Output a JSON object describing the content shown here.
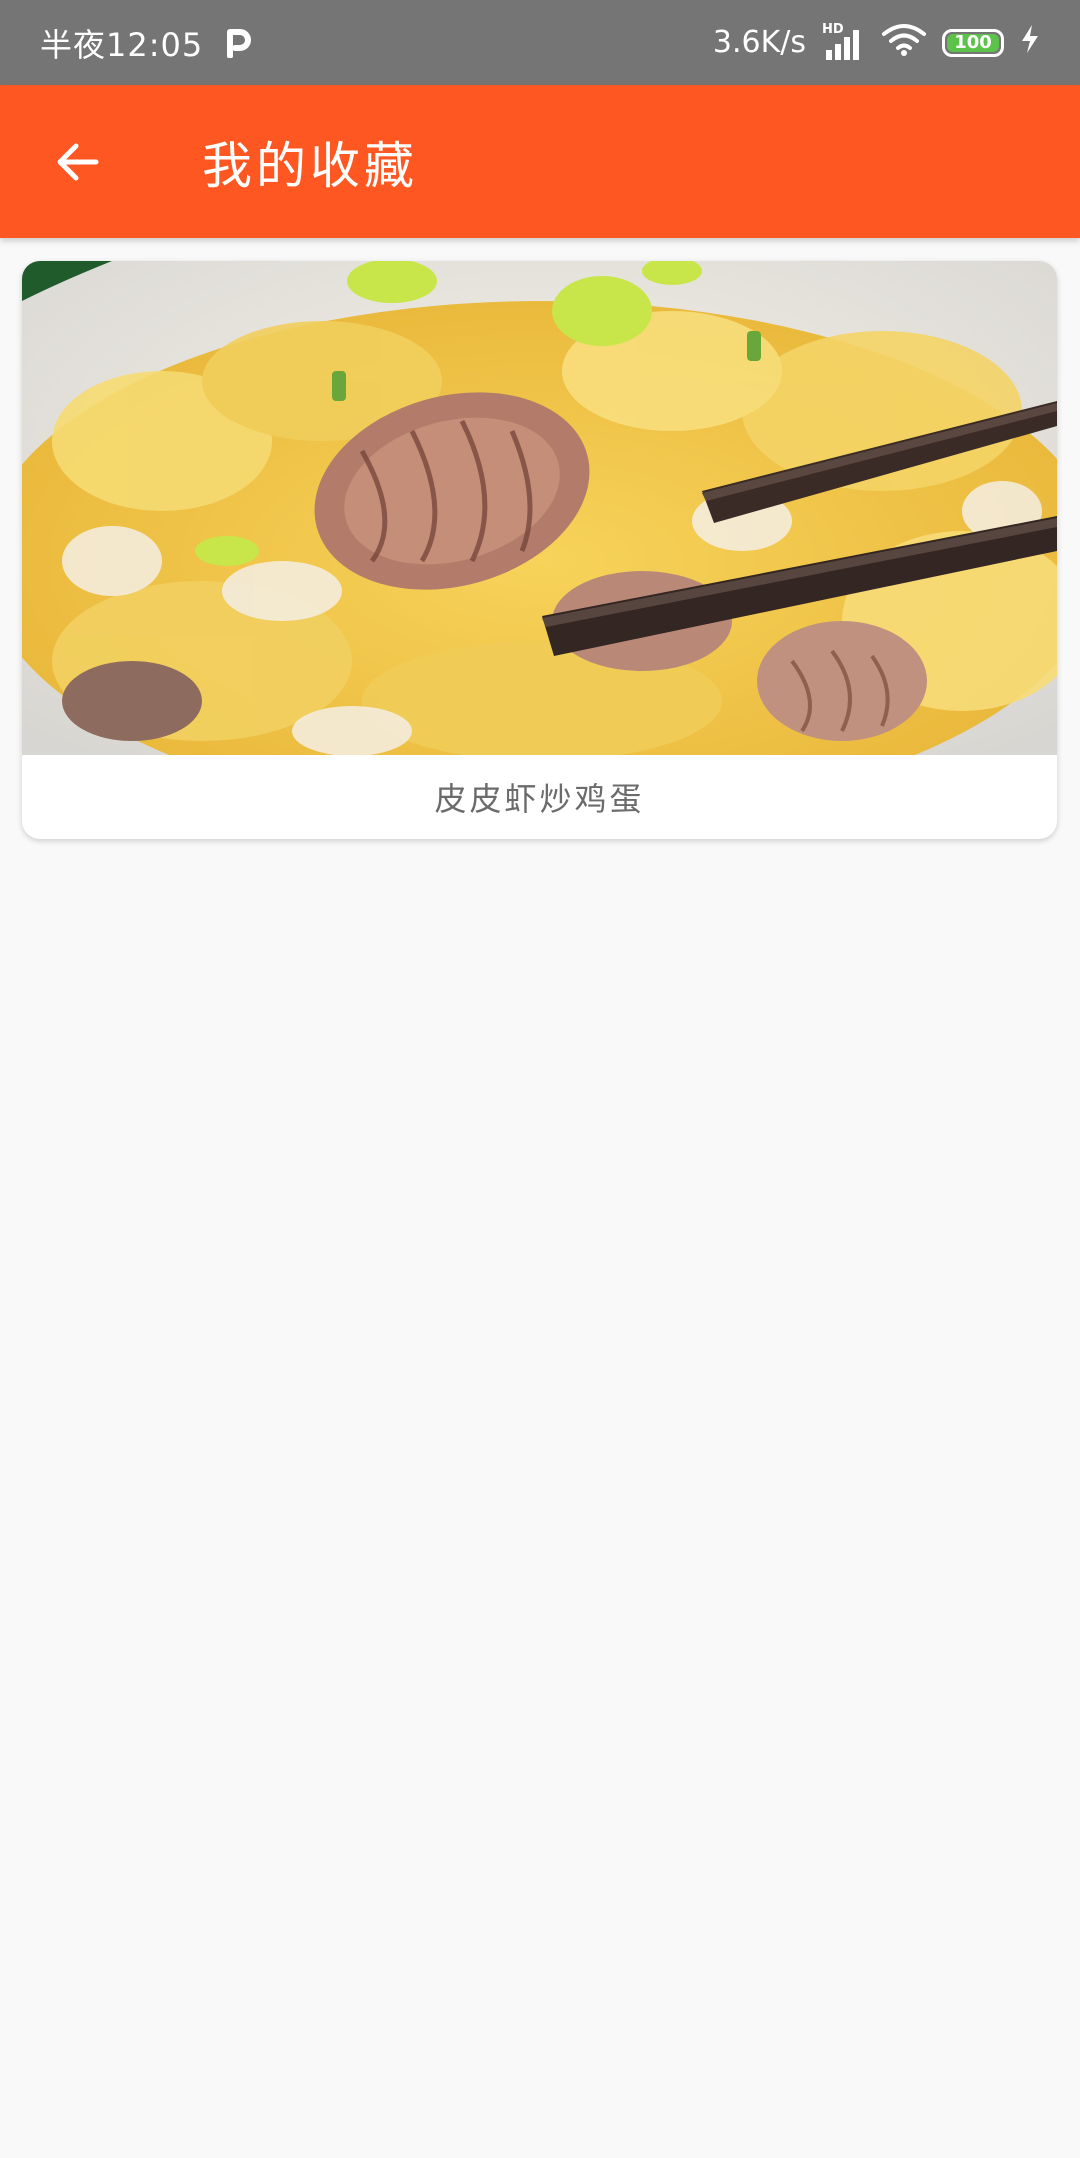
{
  "status_bar": {
    "time": "半夜12:05",
    "app_badge_icon": "p-badge-icon",
    "network_speed": "3.6K/s",
    "hd_label": "HD",
    "battery_level": "100",
    "charging_icon": "lightning-icon"
  },
  "app_bar": {
    "back_icon": "arrow-left-icon",
    "title": "我的收藏",
    "color": "#ff5722"
  },
  "favorites": [
    {
      "image_icon": "food-photo",
      "title": "皮皮虾炒鸡蛋"
    }
  ]
}
